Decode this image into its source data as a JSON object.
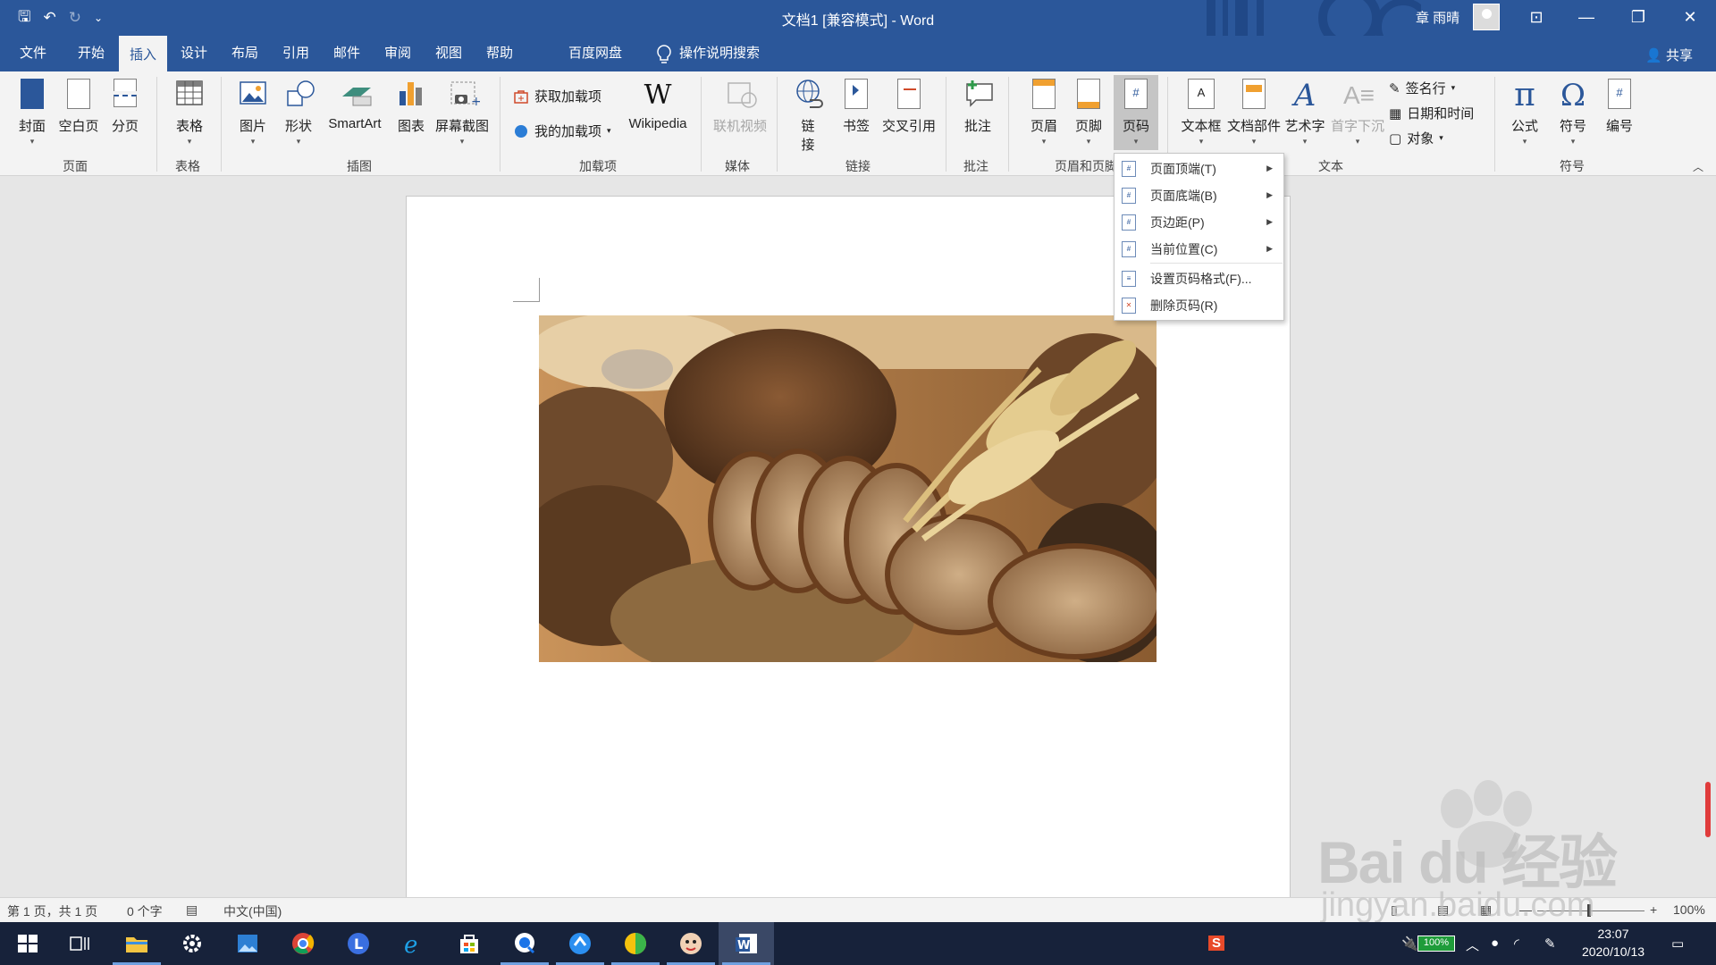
{
  "titlebar": {
    "title": "文档1 [兼容模式] - Word",
    "user": "章 雨晴",
    "qat_save": "🖫",
    "qat_undo": "↶",
    "qat_redo": "↻",
    "qat_more": "⌄",
    "btn_ribbon_display": "⊡",
    "btn_minimize": "—",
    "btn_restore": "❐",
    "btn_close": "✕"
  },
  "tabs": [
    {
      "label": "文件"
    },
    {
      "label": "开始"
    },
    {
      "label": "插入"
    },
    {
      "label": "设计"
    },
    {
      "label": "布局"
    },
    {
      "label": "引用"
    },
    {
      "label": "邮件"
    },
    {
      "label": "审阅"
    },
    {
      "label": "视图"
    },
    {
      "label": "帮助"
    },
    {
      "label": "百度网盘"
    },
    {
      "label": "操作说明搜索"
    }
  ],
  "share_label": "共享",
  "ribbon": {
    "cover": "封面",
    "blank": "空白页",
    "pagebreak": "分页",
    "table": "表格",
    "picture": "图片",
    "shapes": "形状",
    "smartart": "SmartArt",
    "chart": "图表",
    "screenshot": "屏幕截图",
    "get_addins": "获取加载项",
    "my_addins": "我的加载项",
    "wikipedia": "Wikipedia",
    "online_video": "联机视频",
    "link_a": "链",
    "link_b": "接",
    "bookmark": "书签",
    "crossref": "交叉引用",
    "comment": "批注",
    "header": "页眉",
    "footer": "页脚",
    "pagenum": "页码",
    "textbox": "文本框",
    "quickparts": "文档部件",
    "wordart": "艺术字",
    "dropcap": "首字下沉",
    "signature": "签名行",
    "datetime": "日期和时间",
    "object": "对象",
    "equation": "公式",
    "symbol": "符号",
    "number": "编号",
    "groups": {
      "pages": "页面",
      "tables": "表格",
      "illustrations": "插图",
      "addins": "加载项",
      "media": "媒体",
      "links": "链接",
      "comments": "批注",
      "headerfooter": "页眉和页脚",
      "text": "文本",
      "symbols": "符号"
    }
  },
  "menu": {
    "items": [
      {
        "label": "页面顶端(T)"
      },
      {
        "label": "页面底端(B)"
      },
      {
        "label": "页边距(P)"
      },
      {
        "label": "当前位置(C)"
      },
      {
        "label": "设置页码格式(F)..."
      },
      {
        "label": "删除页码(R)"
      }
    ]
  },
  "status": {
    "page": "第 1 页，共 1 页",
    "words": "0 个字",
    "lang": "中文(中国)",
    "zoom": "100%"
  },
  "taskbar": {
    "time": "23:07",
    "date": "2020/10/13",
    "battery": "100%"
  },
  "watermark": {
    "brand": "Bai du 经验",
    "url": "jingyan.baidu.com"
  },
  "colors": {
    "word_blue": "#2b579a",
    "ribbon_bg": "#f3f3f3",
    "taskbar_bg": "#17223a"
  }
}
